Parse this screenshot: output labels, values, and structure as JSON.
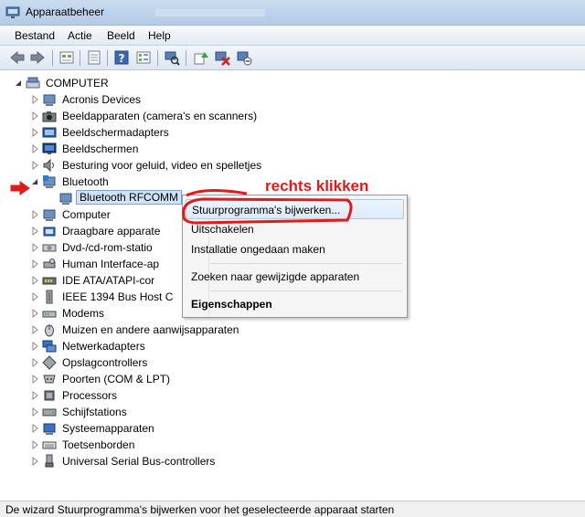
{
  "window": {
    "title": "Apparaatbeheer"
  },
  "menubar": {
    "items": [
      "Bestand",
      "Actie",
      "Beeld",
      "Help"
    ]
  },
  "toolbar": {
    "buttons": [
      "back-icon",
      "forward-icon",
      "up-level-icon",
      "properties-icon",
      "help-icon",
      "console-tree-icon",
      "scan-hardware-icon",
      "update-driver-icon",
      "uninstall-icon",
      "disable-icon"
    ]
  },
  "tree": {
    "root": "COMPUTER",
    "items": [
      "Acronis Devices",
      "Beeldapparaten (camera's en scanners)",
      "Beeldschermadapters",
      "Beeldschermen",
      "Besturing voor geluid, video en spelletjes",
      "Bluetooth",
      "Bluetooth RFCOMM",
      "Computer",
      "Draagbare apparate",
      "Dvd-/cd-rom-statio",
      "Human Interface-ap",
      "IDE ATA/ATAPI-cor",
      "IEEE 1394 Bus Host C",
      "Modems",
      "Muizen en andere aanwijsapparaten",
      "Netwerkadapters",
      "Opslagcontrollers",
      "Poorten (COM & LPT)",
      "Processors",
      "Schijfstations",
      "Systeemapparaten",
      "Toetsenborden",
      "Universal Serial Bus-controllers"
    ]
  },
  "context_menu": {
    "items": [
      "Stuurprogramma's bijwerken...",
      "Uitschakelen",
      "Installatie ongedaan maken",
      "Zoeken naar gewijzigde apparaten",
      "Eigenschappen"
    ]
  },
  "annotation": {
    "text": "rechts klikken",
    "color": "#e01b1b"
  },
  "statusbar": {
    "text": "De wizard Stuurprogramma's bijwerken voor het geselecteerde apparaat starten"
  }
}
